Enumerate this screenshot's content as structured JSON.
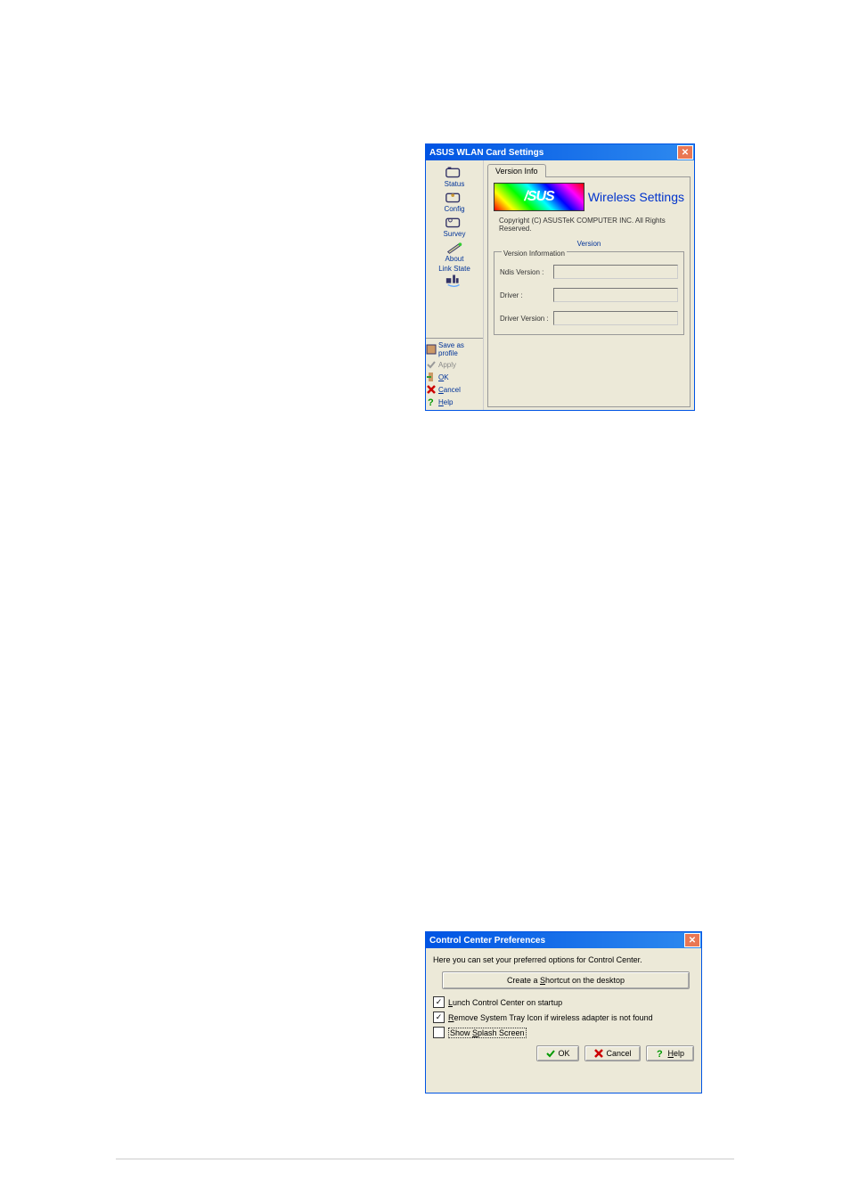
{
  "dialog1": {
    "title": "ASUS WLAN Card Settings",
    "sidebar": {
      "status": "Status",
      "config": "Config",
      "survey": "Survey",
      "about": "About",
      "linkstate": "Link State"
    },
    "sidebar_actions": {
      "save_profile": "Save as profile",
      "apply": "Apply",
      "ok": "OK",
      "cancel": "Cancel",
      "help": "Help"
    },
    "tab": "Version Info",
    "logo_text": "/SUS",
    "heading": "Wireless Settings",
    "copyright": "Copyright (C) ASUSTeK COMPUTER INC. All Rights Reserved.",
    "version_label": "Version",
    "fieldset_label": "Version Information",
    "fields": {
      "ndis": "Ndis Version :",
      "driver": "Driver :",
      "driver_version": "Driver Version :"
    }
  },
  "dialog2": {
    "title": "Control Center Preferences",
    "description": "Here you can set your preferred options for Control Center.",
    "shortcut_btn": "Create a Shortcut on the desktop",
    "check_lunch": "Lunch Control Center on startup",
    "check_lunch_accel": "L",
    "check_remove": "Remove System Tray Icon if wireless adapter is not found",
    "check_remove_accel": "R",
    "check_splash": "Show Splash Screen",
    "check_splash_accel": "S",
    "check_shortcut_accel": "S",
    "buttons": {
      "ok": "OK",
      "cancel": "Cancel",
      "help": "Help",
      "help_accel": "H"
    }
  }
}
